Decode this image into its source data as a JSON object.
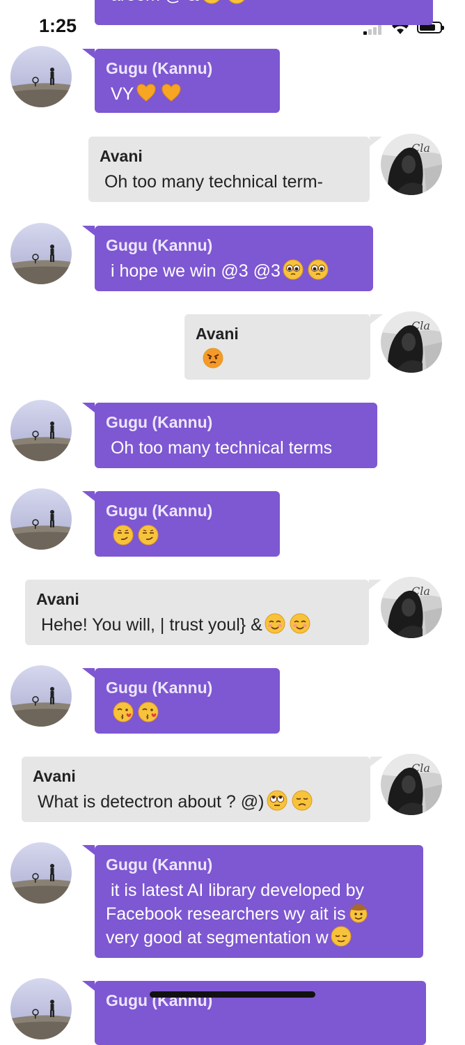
{
  "status_bar": {
    "time": "1:25"
  },
  "messages": [
    {
      "sender": "",
      "text": "aroom @ &",
      "emojis": [
        "grin-sweat",
        "relieved"
      ],
      "side": "left"
    },
    {
      "sender": "Gugu (Kannu)",
      "text": "VY",
      "emojis": [
        "orange-heart",
        "orange-heart"
      ],
      "side": "left"
    },
    {
      "sender": "Avani",
      "text": "Oh too many technical term-",
      "emojis": [],
      "side": "right"
    },
    {
      "sender": "Gugu (Kannu)",
      "text": "i hope we win @3 @3",
      "emojis": [
        "pleading",
        "pleading"
      ],
      "side": "left"
    },
    {
      "sender": "Avani",
      "text": "",
      "emojis": [
        "angry"
      ],
      "side": "right"
    },
    {
      "sender": "Gugu (Kannu)",
      "text": "Oh too many technical terms",
      "emojis": [],
      "side": "left"
    },
    {
      "sender": "Gugu (Kannu)",
      "text": "",
      "emojis": [
        "smirk",
        "smirk"
      ],
      "side": "left"
    },
    {
      "sender": "Avani",
      "text": "Hehe! You will, | trust youl} &",
      "emojis": [
        "blush",
        "blush"
      ],
      "side": "right"
    },
    {
      "sender": "Gugu (Kannu)",
      "text": "",
      "emojis": [
        "kiss-heart",
        "kiss-heart"
      ],
      "side": "left"
    },
    {
      "sender": "Avani",
      "text": "What is detectron about ? @)",
      "emojis": [
        "eye-roll",
        "disappointed"
      ],
      "side": "right"
    },
    {
      "sender": "Gugu (Kannu)",
      "text": "it is latest AI library developed by Facebook researchers wy ait is",
      "text2": "very good at segmentation w",
      "emojis": [
        "cowboy"
      ],
      "emojis2": [
        "relieved"
      ],
      "side": "left"
    },
    {
      "sender": "Gugu (Kannu)",
      "text": "",
      "emojis": [],
      "side": "left"
    }
  ]
}
